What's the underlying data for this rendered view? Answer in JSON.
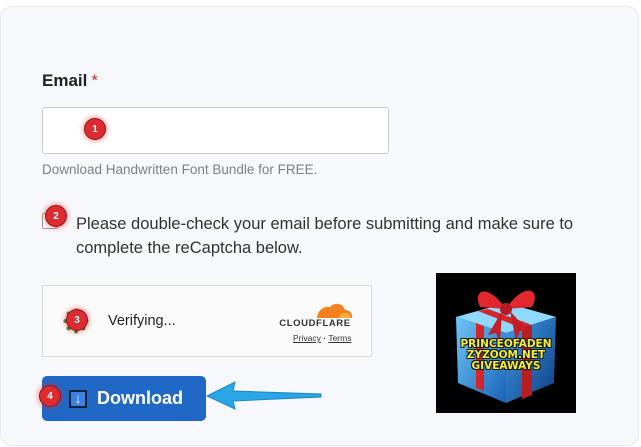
{
  "form": {
    "email_label": "Email",
    "required_mark": "*",
    "email_value": "",
    "email_placeholder": "",
    "hint": "Download Handwritten Font Bundle for FREE.",
    "confirm_text": "Please double-check your email before submitting and make sure to complete the reCaptcha below.",
    "confirm_checked": false
  },
  "captcha": {
    "status": "Verifying...",
    "brand": "CLOUDFLARE",
    "privacy": "Privacy",
    "separator": "·",
    "terms": "Terms"
  },
  "download_button": {
    "label": "Download",
    "icon": "↓"
  },
  "gift_image": {
    "line1": "PRINCEOFADEN",
    "line2": "ZYZOOM.NET",
    "line3": "GIVEAWAYS"
  },
  "annotations": {
    "badge_1": "1",
    "badge_2": "2",
    "badge_3": "3",
    "badge_4": "4"
  },
  "colors": {
    "accent": "#1f68c6",
    "badge": "#dc2b31",
    "arrow": "#2aa6e6",
    "cloudflare": "#f48120"
  }
}
